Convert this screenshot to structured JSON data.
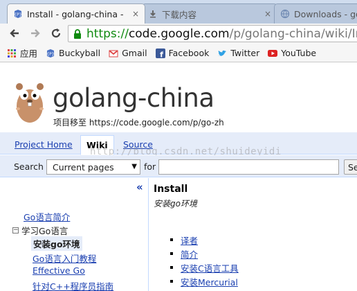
{
  "browser": {
    "tabs": [
      {
        "title": "Install - golang-china -",
        "close": "×",
        "active": true
      },
      {
        "title": "下载内容",
        "close": "×",
        "active": false
      },
      {
        "title": "Downloads - go",
        "close": "×",
        "active": false
      }
    ],
    "url": {
      "scheme": "https://",
      "host": "code.google.com",
      "path": "/p/golang-china/wiki/Insta"
    },
    "bookmarks": [
      {
        "label": "应用",
        "icon": "apps-grid-icon"
      },
      {
        "label": "Buckyball",
        "icon": "google-code-icon"
      },
      {
        "label": "Gmail",
        "icon": "gmail-icon"
      },
      {
        "label": "Facebook",
        "icon": "facebook-icon"
      },
      {
        "label": "Twitter",
        "icon": "twitter-icon"
      },
      {
        "label": "YouTube",
        "icon": "youtube-icon"
      }
    ]
  },
  "site": {
    "title": "golang-china",
    "moved_notice": "项目移至 https://code.google.com/p/go-zh"
  },
  "project_tabs": {
    "home": "Project Home",
    "wiki": "Wiki",
    "source": "Source"
  },
  "watermark": "http://blog.csdn.net/shuideyidi",
  "search": {
    "label": "Search",
    "scope": "Current pages",
    "for_label": "for",
    "query": "",
    "button": "Search"
  },
  "sidebar": {
    "collapse": "«",
    "items": [
      {
        "label": "Go语言简介"
      },
      {
        "label": "学习Go语言",
        "toggle": "−"
      },
      {
        "label": "安装go环境"
      },
      {
        "label": "Go语言入门教程"
      },
      {
        "label": "Effective Go"
      },
      {
        "label": "针对C++程序员指南"
      }
    ]
  },
  "content": {
    "title": "Install",
    "summary": "安装go环境",
    "toc": [
      "译者",
      "简介",
      "安装C语言工具",
      "安装Mercurial"
    ]
  },
  "colors": {
    "link": "#1a3fb0",
    "project_bar": "#e5ecf9",
    "border": "#c3d9ff",
    "secure_green": "#108a10"
  }
}
